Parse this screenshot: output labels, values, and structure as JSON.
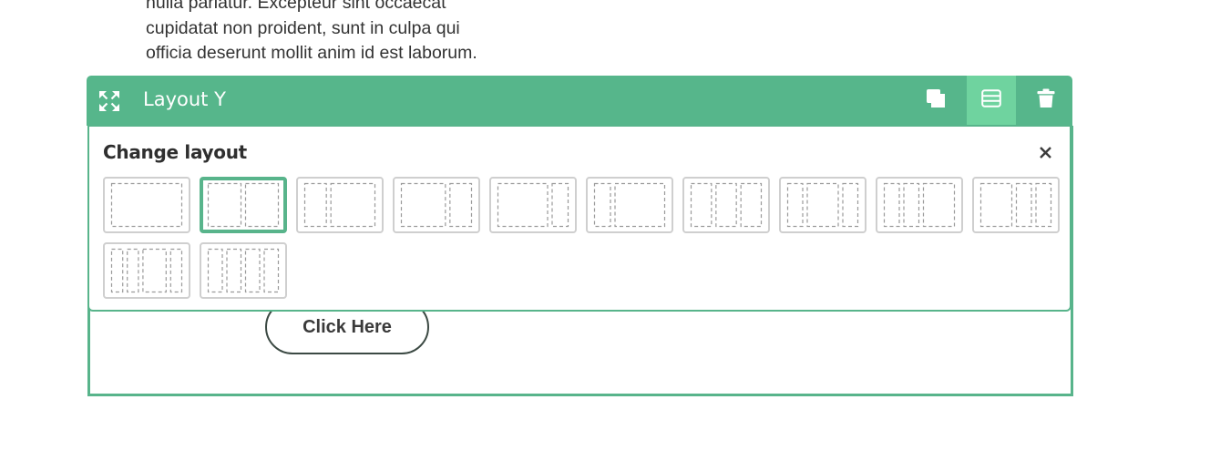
{
  "body_text": {
    "lines": [
      "",
      "nulla pariatur. Excepteur sint occaecat",
      "cupidatat non proident, sunt in culpa qui",
      "officia deserunt mollit anim id est laborum."
    ]
  },
  "toolbar": {
    "title": "Layout Y",
    "move_icon": "move-icon",
    "duplicate_icon": "duplicate-icon",
    "layout_icon": "layout-icon",
    "delete_icon": "trash-icon",
    "active_button": "layout"
  },
  "layout_panel": {
    "title": "Change layout",
    "close_icon": "close-icon",
    "selected_index": 1,
    "options": [
      {
        "columns": [
          1
        ]
      },
      {
        "columns": [
          1,
          1
        ]
      },
      {
        "columns": [
          1,
          2
        ]
      },
      {
        "columns": [
          2,
          1
        ]
      },
      {
        "columns": [
          3,
          1
        ]
      },
      {
        "columns": [
          1,
          3
        ]
      },
      {
        "columns": [
          1,
          1,
          1
        ]
      },
      {
        "columns": [
          1,
          2,
          1
        ]
      },
      {
        "columns": [
          1,
          1,
          2
        ]
      },
      {
        "columns": [
          2,
          1,
          1
        ]
      },
      {
        "columns": [
          1,
          1,
          2,
          1
        ]
      },
      {
        "columns": [
          1,
          1,
          1,
          1
        ]
      }
    ]
  },
  "cta": {
    "label": "Click Here"
  },
  "colors": {
    "accent": "#56b68b",
    "accent_active": "#6fd39f",
    "option_border": "#cfcfcf",
    "dashed": "#9a9a9a"
  }
}
